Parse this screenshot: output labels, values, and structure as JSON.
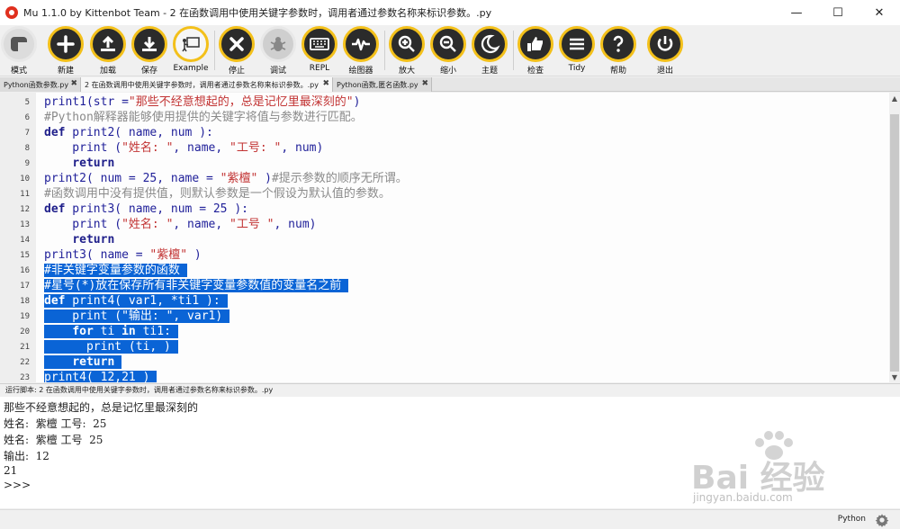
{
  "window": {
    "title": "Mu 1.1.0 by Kittenbot Team - 2 在函数调用中使用关键字参数时，调用者通过参数名称来标识参数。.py",
    "minimize": "—",
    "maximize": "☐",
    "close": "✕"
  },
  "toolbar": {
    "buttons": [
      {
        "label": "模式",
        "icon": "mode-icon"
      },
      {
        "label": "新建",
        "icon": "plus-icon"
      },
      {
        "label": "加载",
        "icon": "upload-icon"
      },
      {
        "label": "保存",
        "icon": "download-icon"
      },
      {
        "label": "Example",
        "icon": "presentation-icon"
      },
      {
        "label": "停止",
        "icon": "stop-icon"
      },
      {
        "label": "调试",
        "icon": "bug-icon"
      },
      {
        "label": "REPL",
        "icon": "keyboard-icon"
      },
      {
        "label": "绘图器",
        "icon": "plotter-icon"
      },
      {
        "label": "放大",
        "icon": "zoom-in-icon"
      },
      {
        "label": "缩小",
        "icon": "zoom-out-icon"
      },
      {
        "label": "主题",
        "icon": "moon-icon"
      },
      {
        "label": "检查",
        "icon": "thumbs-up-icon"
      },
      {
        "label": "Tidy",
        "icon": "tidy-icon"
      },
      {
        "label": "帮助",
        "icon": "help-icon"
      },
      {
        "label": "退出",
        "icon": "power-icon"
      }
    ],
    "accent": "#f3c01a"
  },
  "tabs": [
    {
      "label": "Python函数参数.py",
      "close": "✖"
    },
    {
      "label": "2 在函数调用中使用关键字参数时，调用者通过参数名称来标识参数。.py",
      "close": "✖"
    },
    {
      "label": "Python函数,匿名函数.py",
      "close": "✖"
    }
  ],
  "editor": {
    "line_numbers": [
      "5",
      "6",
      "7",
      "8",
      "9",
      "10",
      "11",
      "12",
      "13",
      "14",
      "15",
      "16",
      "17",
      "18",
      "19",
      "20",
      "21",
      "22",
      "23"
    ],
    "lines": [
      "print1(str =\"那些不经意想起的，总是记忆里最深刻的\")",
      "#Python解释器能够使用提供的关键字将值与参数进行匹配。",
      "def print2( name, num ):",
      "    print (\"姓名: \", name, \"工号: \", num)",
      "    return",
      "print2( num = 25, name = \"紫檀\" )#提示参数的顺序无所谓。",
      "#函数调用中没有提供值，则默认参数是一个假设为默认值的参数。",
      "def print3( name, num = 25 ):",
      "    print (\"姓名: \", name, \"工号 \", num)",
      "    return",
      "print3( name = \"紫檀\" )",
      "#非关键字变量参数的函数",
      "#星号(*)放在保存所有非关键字变量参数值的变量名之前",
      "def print4( var1, *ti1 ):",
      "    print (\"输出: \", var1)",
      "    for ti in ti1:",
      "      print (ti, )",
      "    return",
      "print4( 12,21 )"
    ],
    "selection_color": "#0a64d6"
  },
  "run": {
    "header": "运行脚本: 2 在函数调用中使用关键字参数时，调用者通过参数名称来标识参数。.py",
    "output": [
      "那些不经意想起的，总是记忆里最深刻的",
      "姓名:  紫檀 工号:  25",
      "姓名:  紫檀 工号  25",
      "输出:  12",
      "21",
      ">>>"
    ]
  },
  "watermark": {
    "text": "Bai 经验",
    "url": "jingyan.baidu.com"
  },
  "status": {
    "mode": "Python"
  }
}
